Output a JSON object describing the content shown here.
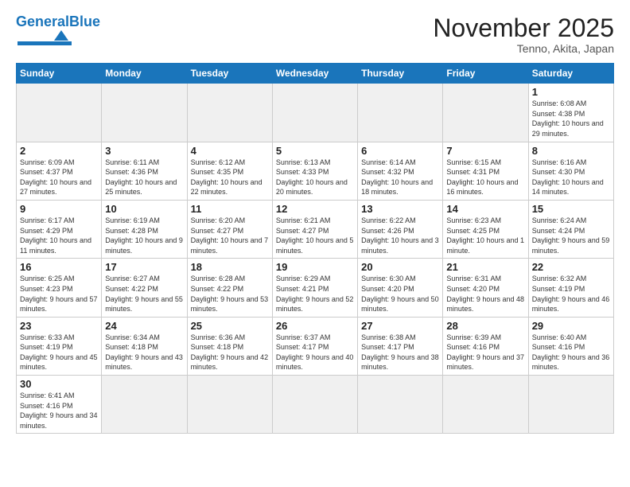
{
  "header": {
    "logo_general": "General",
    "logo_blue": "Blue",
    "title": "November 2025",
    "location": "Tenno, Akita, Japan"
  },
  "days_of_week": [
    "Sunday",
    "Monday",
    "Tuesday",
    "Wednesday",
    "Thursday",
    "Friday",
    "Saturday"
  ],
  "weeks": [
    [
      {
        "day": "",
        "info": "",
        "empty": true
      },
      {
        "day": "",
        "info": "",
        "empty": true
      },
      {
        "day": "",
        "info": "",
        "empty": true
      },
      {
        "day": "",
        "info": "",
        "empty": true
      },
      {
        "day": "",
        "info": "",
        "empty": true
      },
      {
        "day": "",
        "info": "",
        "empty": true
      },
      {
        "day": "1",
        "info": "Sunrise: 6:08 AM\nSunset: 4:38 PM\nDaylight: 10 hours\nand 29 minutes."
      }
    ],
    [
      {
        "day": "2",
        "info": "Sunrise: 6:09 AM\nSunset: 4:37 PM\nDaylight: 10 hours\nand 27 minutes."
      },
      {
        "day": "3",
        "info": "Sunrise: 6:11 AM\nSunset: 4:36 PM\nDaylight: 10 hours\nand 25 minutes."
      },
      {
        "day": "4",
        "info": "Sunrise: 6:12 AM\nSunset: 4:35 PM\nDaylight: 10 hours\nand 22 minutes."
      },
      {
        "day": "5",
        "info": "Sunrise: 6:13 AM\nSunset: 4:33 PM\nDaylight: 10 hours\nand 20 minutes."
      },
      {
        "day": "6",
        "info": "Sunrise: 6:14 AM\nSunset: 4:32 PM\nDaylight: 10 hours\nand 18 minutes."
      },
      {
        "day": "7",
        "info": "Sunrise: 6:15 AM\nSunset: 4:31 PM\nDaylight: 10 hours\nand 16 minutes."
      },
      {
        "day": "8",
        "info": "Sunrise: 6:16 AM\nSunset: 4:30 PM\nDaylight: 10 hours\nand 14 minutes."
      }
    ],
    [
      {
        "day": "9",
        "info": "Sunrise: 6:17 AM\nSunset: 4:29 PM\nDaylight: 10 hours\nand 11 minutes."
      },
      {
        "day": "10",
        "info": "Sunrise: 6:19 AM\nSunset: 4:28 PM\nDaylight: 10 hours\nand 9 minutes."
      },
      {
        "day": "11",
        "info": "Sunrise: 6:20 AM\nSunset: 4:27 PM\nDaylight: 10 hours\nand 7 minutes."
      },
      {
        "day": "12",
        "info": "Sunrise: 6:21 AM\nSunset: 4:27 PM\nDaylight: 10 hours\nand 5 minutes."
      },
      {
        "day": "13",
        "info": "Sunrise: 6:22 AM\nSunset: 4:26 PM\nDaylight: 10 hours\nand 3 minutes."
      },
      {
        "day": "14",
        "info": "Sunrise: 6:23 AM\nSunset: 4:25 PM\nDaylight: 10 hours\nand 1 minute."
      },
      {
        "day": "15",
        "info": "Sunrise: 6:24 AM\nSunset: 4:24 PM\nDaylight: 9 hours\nand 59 minutes."
      }
    ],
    [
      {
        "day": "16",
        "info": "Sunrise: 6:25 AM\nSunset: 4:23 PM\nDaylight: 9 hours\nand 57 minutes."
      },
      {
        "day": "17",
        "info": "Sunrise: 6:27 AM\nSunset: 4:22 PM\nDaylight: 9 hours\nand 55 minutes."
      },
      {
        "day": "18",
        "info": "Sunrise: 6:28 AM\nSunset: 4:22 PM\nDaylight: 9 hours\nand 53 minutes."
      },
      {
        "day": "19",
        "info": "Sunrise: 6:29 AM\nSunset: 4:21 PM\nDaylight: 9 hours\nand 52 minutes."
      },
      {
        "day": "20",
        "info": "Sunrise: 6:30 AM\nSunset: 4:20 PM\nDaylight: 9 hours\nand 50 minutes."
      },
      {
        "day": "21",
        "info": "Sunrise: 6:31 AM\nSunset: 4:20 PM\nDaylight: 9 hours\nand 48 minutes."
      },
      {
        "day": "22",
        "info": "Sunrise: 6:32 AM\nSunset: 4:19 PM\nDaylight: 9 hours\nand 46 minutes."
      }
    ],
    [
      {
        "day": "23",
        "info": "Sunrise: 6:33 AM\nSunset: 4:19 PM\nDaylight: 9 hours\nand 45 minutes."
      },
      {
        "day": "24",
        "info": "Sunrise: 6:34 AM\nSunset: 4:18 PM\nDaylight: 9 hours\nand 43 minutes."
      },
      {
        "day": "25",
        "info": "Sunrise: 6:36 AM\nSunset: 4:18 PM\nDaylight: 9 hours\nand 42 minutes."
      },
      {
        "day": "26",
        "info": "Sunrise: 6:37 AM\nSunset: 4:17 PM\nDaylight: 9 hours\nand 40 minutes."
      },
      {
        "day": "27",
        "info": "Sunrise: 6:38 AM\nSunset: 4:17 PM\nDaylight: 9 hours\nand 38 minutes."
      },
      {
        "day": "28",
        "info": "Sunrise: 6:39 AM\nSunset: 4:16 PM\nDaylight: 9 hours\nand 37 minutes."
      },
      {
        "day": "29",
        "info": "Sunrise: 6:40 AM\nSunset: 4:16 PM\nDaylight: 9 hours\nand 36 minutes."
      }
    ],
    [
      {
        "day": "30",
        "info": "Sunrise: 6:41 AM\nSunset: 4:16 PM\nDaylight: 9 hours\nand 34 minutes."
      },
      {
        "day": "",
        "info": "",
        "empty": true
      },
      {
        "day": "",
        "info": "",
        "empty": true
      },
      {
        "day": "",
        "info": "",
        "empty": true
      },
      {
        "day": "",
        "info": "",
        "empty": true
      },
      {
        "day": "",
        "info": "",
        "empty": true
      },
      {
        "day": "",
        "info": "",
        "empty": true
      }
    ]
  ]
}
